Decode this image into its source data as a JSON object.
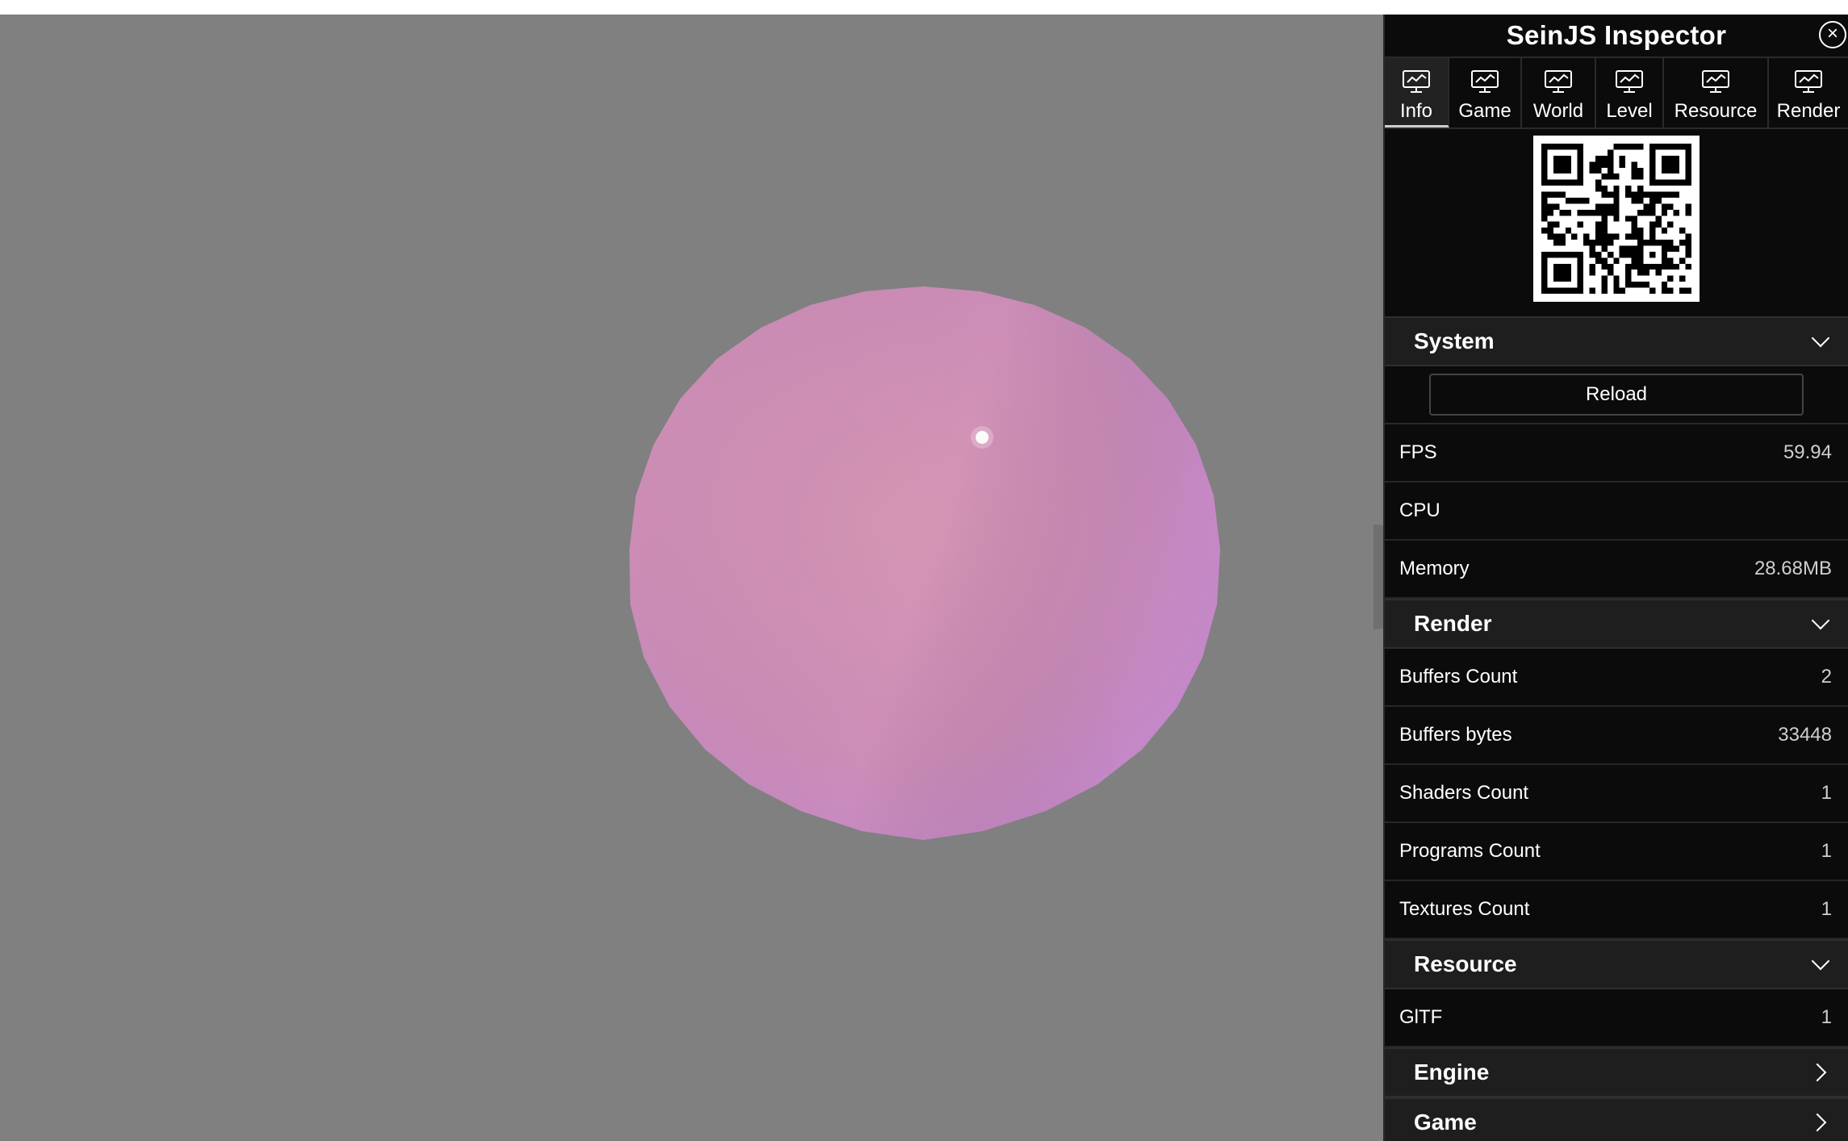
{
  "inspector": {
    "title": "SeinJS Inspector",
    "tabs": [
      {
        "label": "Info",
        "active": true
      },
      {
        "label": "Game"
      },
      {
        "label": "World"
      },
      {
        "label": "Level"
      },
      {
        "label": "Resource"
      },
      {
        "label": "Render"
      }
    ],
    "sections": {
      "system": {
        "title": "System",
        "reload_label": "Reload",
        "rows": [
          {
            "label": "FPS",
            "value": "59.94"
          },
          {
            "label": "CPU",
            "value": ""
          },
          {
            "label": "Memory",
            "value": "28.68MB"
          }
        ]
      },
      "render": {
        "title": "Render",
        "rows": [
          {
            "label": "Buffers Count",
            "value": "2"
          },
          {
            "label": "Buffers bytes",
            "value": "33448"
          },
          {
            "label": "Shaders Count",
            "value": "1"
          },
          {
            "label": "Programs Count",
            "value": "1"
          },
          {
            "label": "Textures Count",
            "value": "1"
          }
        ]
      },
      "resource": {
        "title": "Resource",
        "rows": [
          {
            "label": "GlTF",
            "value": "1"
          }
        ]
      },
      "engine": {
        "title": "Engine"
      },
      "game": {
        "title": "Game"
      }
    }
  },
  "colors": {
    "viewport_bg": "#808080",
    "sphere": "#cf8fb8",
    "panel_bg": "#0b0b0b",
    "section_bg": "#1e1e1e"
  }
}
